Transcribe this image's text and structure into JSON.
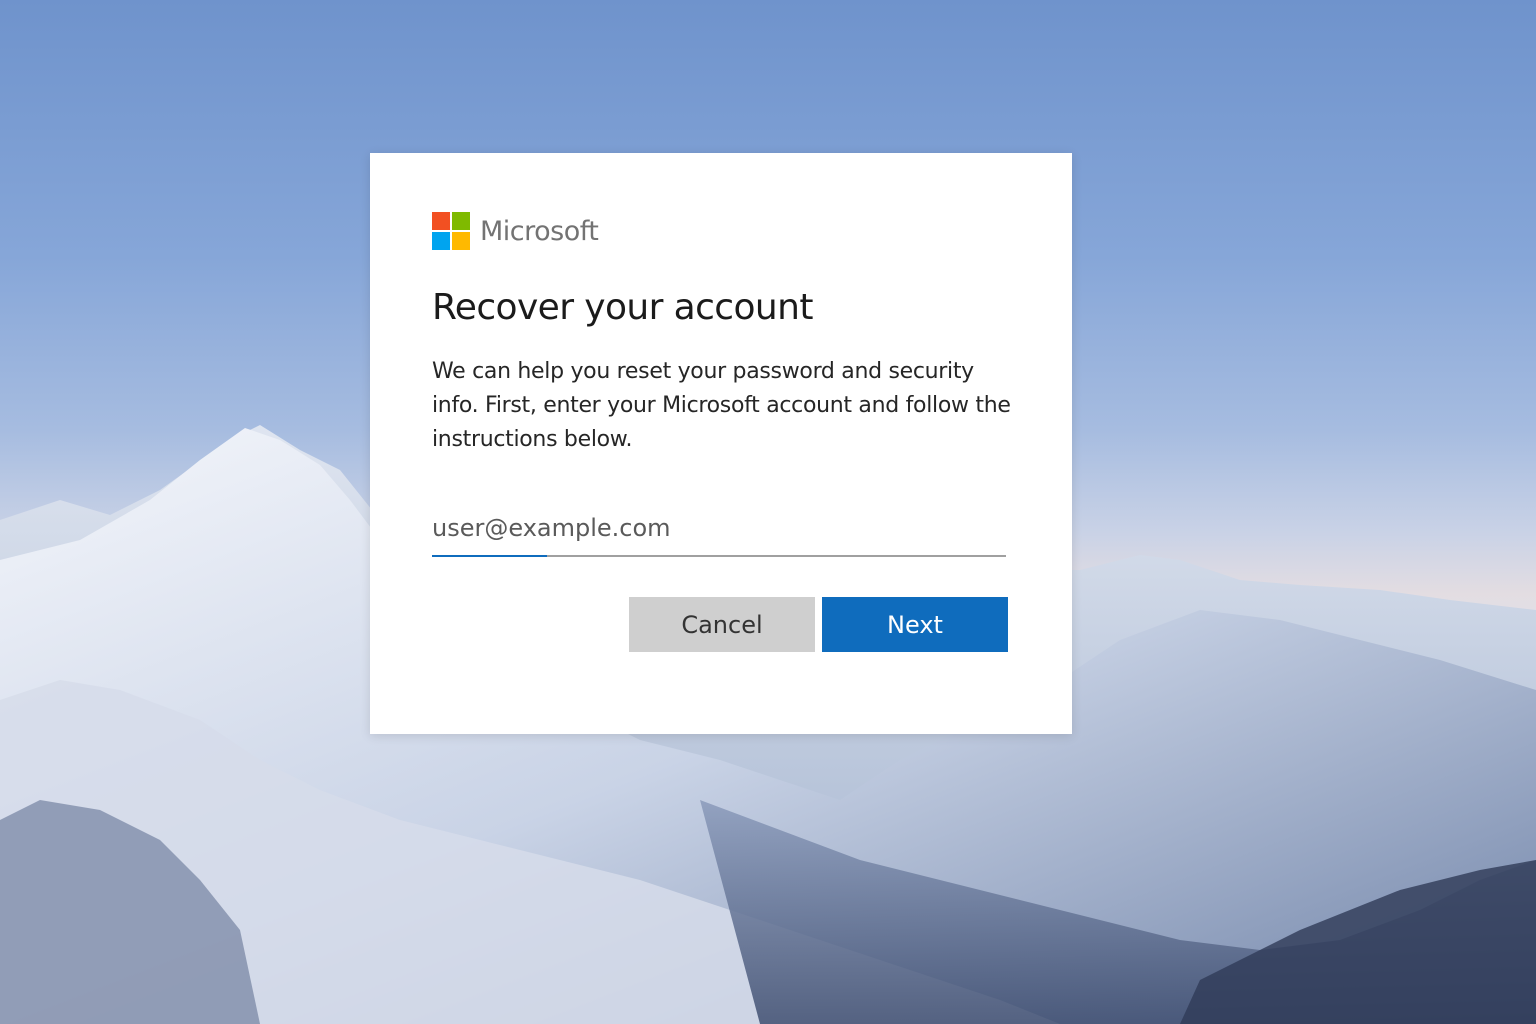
{
  "background": {
    "description_icon": "mountain-landscape",
    "sky_color": "#7fa0d6"
  },
  "dialog": {
    "brand": {
      "name": "Microsoft",
      "logo_icon": "microsoft-logo-icon",
      "logo_colors": [
        "#f25022",
        "#7fba00",
        "#00a4ef",
        "#ffb900"
      ]
    },
    "title": "Recover your account",
    "description": "We can help you reset your password and security info. First, enter your Microsoft account and follow the instructions below.",
    "email_field": {
      "value": "user@example.com",
      "placeholder": "user@example.com"
    },
    "buttons": {
      "cancel_label": "Cancel",
      "next_label": "Next"
    },
    "accent_color": "#0f6cbd"
  }
}
